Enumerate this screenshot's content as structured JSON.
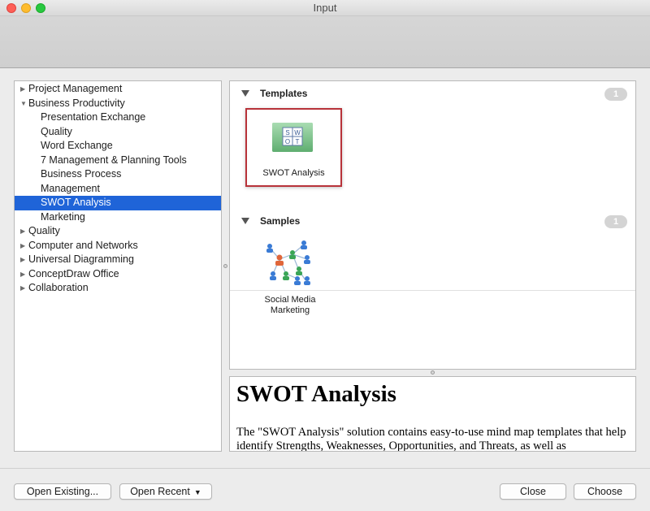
{
  "window": {
    "title": "Input"
  },
  "tree": {
    "items": [
      {
        "label": "Project Management",
        "level": 0,
        "expander": "collapsed",
        "selected": false
      },
      {
        "label": "Business Productivity",
        "level": 0,
        "expander": "expanded",
        "selected": false
      },
      {
        "label": "Presentation Exchange",
        "level": 1,
        "expander": "none",
        "selected": false
      },
      {
        "label": "Quality",
        "level": 1,
        "expander": "none",
        "selected": false
      },
      {
        "label": "Word Exchange",
        "level": 1,
        "expander": "none",
        "selected": false
      },
      {
        "label": "7 Management & Planning Tools",
        "level": 1,
        "expander": "none",
        "selected": false
      },
      {
        "label": "Business Process",
        "level": 1,
        "expander": "none",
        "selected": false
      },
      {
        "label": "Management",
        "level": 1,
        "expander": "none",
        "selected": false
      },
      {
        "label": "SWOT Analysis",
        "level": 1,
        "expander": "none",
        "selected": true
      },
      {
        "label": "Marketing",
        "level": 1,
        "expander": "none",
        "selected": false
      },
      {
        "label": "Quality",
        "level": 0,
        "expander": "collapsed",
        "selected": false
      },
      {
        "label": "Computer and Networks",
        "level": 0,
        "expander": "collapsed",
        "selected": false
      },
      {
        "label": "Universal Diagramming",
        "level": 0,
        "expander": "collapsed",
        "selected": false
      },
      {
        "label": "ConceptDraw Office",
        "level": 0,
        "expander": "collapsed",
        "selected": false
      },
      {
        "label": "Collaboration",
        "level": 0,
        "expander": "collapsed",
        "selected": false
      }
    ]
  },
  "gallery": {
    "templates": {
      "title": "Templates",
      "count": "1",
      "items": [
        {
          "label": "SWOT Analysis",
          "icon": "swot-icon"
        }
      ]
    },
    "samples": {
      "title": "Samples",
      "count": "1",
      "items": [
        {
          "label_line1": "Social Media",
          "label_line2": "Marketing",
          "icon": "social-network-icon"
        }
      ]
    }
  },
  "swot_icon_letters": [
    "S",
    "W",
    "O",
    "T"
  ],
  "description": {
    "title": "SWOT Analysis",
    "body": "The \"SWOT Analysis\" solution contains easy-to-use mind map templates that help identify Strengths, Weaknesses, Opportunities, and Threats, as well as"
  },
  "buttons": {
    "open_existing": "Open Existing...",
    "open_recent": "Open Recent",
    "close": "Close",
    "choose": "Choose"
  },
  "colors": {
    "selection": "#1f64d8",
    "highlight_frame": "#b8333a",
    "badge": "#d4d4d4"
  }
}
